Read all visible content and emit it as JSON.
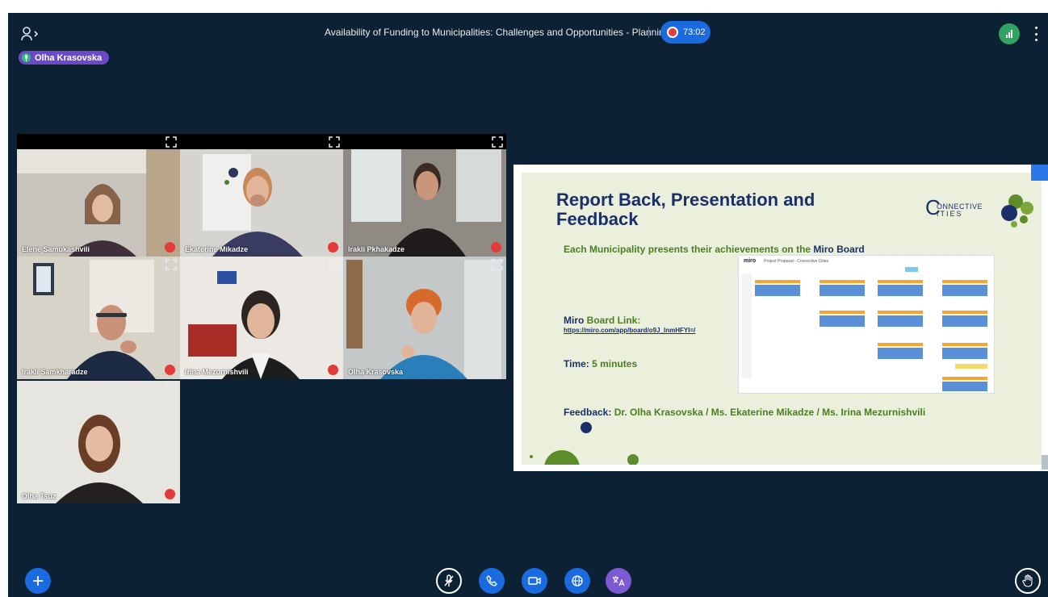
{
  "meeting": {
    "title": "Availability of Funding to Municipalities: Challenges and Opportunities - Plannin…",
    "timer": "73:02",
    "presenter": "Olha Krasovska"
  },
  "participants": [
    {
      "name": "Elene Samukashvili",
      "muted": true
    },
    {
      "name": "Ekaterine Mikadze",
      "muted": true
    },
    {
      "name": "Irakli Pkhakadze",
      "muted": true
    },
    {
      "name": "Irakli Samkharadze",
      "muted": true
    },
    {
      "name": "Irina Mezurnishvili",
      "muted": true
    },
    {
      "name": "Olha Krasovska",
      "muted": false,
      "active": true
    },
    {
      "name": "Olha Tsuz",
      "muted": true
    }
  ],
  "slide": {
    "title": "Report Back, Presentation and Feedback",
    "logo_letter": "C",
    "logo_text_1": "ONNECTIVE",
    "logo_text_2": "ITIES",
    "subtitle_prefix": "Each Municipality presents their achievements on the ",
    "subtitle_bold": "Miro Board",
    "link_label_bold": "Miro",
    "link_label_rest": " Board Link:",
    "link_url": "https://miro.com/app/board/o9J_lnmHFYI=/",
    "time_label": "Time:",
    "time_value": " 5 minutes",
    "feedback_label": "Feedback:",
    "feedback_value": " Dr. Olha Krasovska / Ms. Ekaterine Mikadze / Ms. Irina Mezurnishvili",
    "miro_brand": "miro",
    "miro_board_name": "Project Proposal - Connective Cities"
  },
  "colors": {
    "background": "#0d2134",
    "accent_blue": "#1a6be0",
    "record_red": "#e43d3d",
    "presenter_purple": "#6c49c8",
    "slide_navy": "#1b2f6a",
    "slide_green": "#4d7d22"
  },
  "icons": {
    "users": "users-icon",
    "add": "plus-icon",
    "mic": "mic-muted-icon",
    "phone": "phone-icon",
    "camera": "video-camera-icon",
    "share": "globe-icon",
    "translate": "translate-icon",
    "raise_hand": "hand-icon"
  }
}
